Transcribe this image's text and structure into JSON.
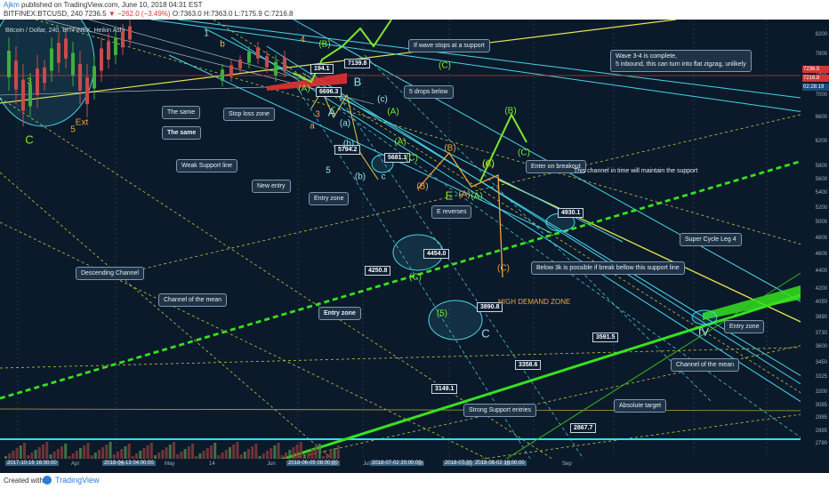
{
  "header": {
    "author": "Ajkm",
    "published": "published on TradingView.com, June 10, 2018 04:31 EST",
    "symbol_line": "BITFINEX:BTCUSD, 240 7236.5",
    "change": "▼ −262.0 (−3.49%)",
    "ohlc": "O:7363.0 H:7363.0 L:7175.9 C:7216.8"
  },
  "footer": {
    "created_with": "Created with",
    "brand": "TradingView"
  },
  "chart_data": {
    "type": "line",
    "title": "Bitcoin / Dollar, 240, BITFINEX, Heikin Ashi",
    "symbol": "BITFINEX:BTCUSD",
    "timeframe": "240",
    "y_axis": {
      "scale": "log",
      "ylim": [
        2700,
        8400
      ],
      "ticks": [
        8200,
        7800,
        7400,
        7000,
        6600,
        6200,
        5800,
        5600,
        5400,
        5200,
        5000,
        4800,
        4600,
        4400,
        4200,
        4050,
        3890,
        3730,
        3600,
        3450,
        3325,
        3200,
        3085,
        2985,
        2885,
        2790
      ]
    },
    "x_axis": {
      "ticks": [
        "2017-10-16 16:00:00",
        "Apr",
        "2018-04-13 04:00:00",
        "16",
        "May",
        "14",
        "Jun",
        "2018-06-05 08:00:00",
        "21",
        "Jul",
        "2018-07-02 20:00:00",
        "16",
        "2018-07-30 12:00:00",
        "Aug",
        "2018-08-02 16:00:00",
        "13",
        "Sep"
      ]
    },
    "current_price_labels": [
      "7236.5",
      "7216.8",
      "02:28:19"
    ],
    "price_tags": [
      "194.1",
      "7139.8",
      "6696.3",
      "5794.2",
      "5681.1",
      "4930.1",
      "4454.0",
      "4250.8",
      "3890.8",
      "3591.5",
      "3358.6",
      "3149.1",
      "2867.7"
    ],
    "annotations": [
      "If wave stops at a support",
      "Wave 3-4 is complete,\n5 inbound, this can turn into flat zigzag, unlikely",
      "5 drops below",
      "The same",
      "Stop loss zone",
      "The same",
      "Weak Support line",
      "New entry",
      "Entry zone",
      "Enter on breakout",
      "This channel in time will maintain the support",
      "E reverses",
      "Descending Channel",
      "Below 3k is possible if break bellow this support line",
      "Channel of the mean",
      "Entry zone",
      "HIGH DEMAND ZONE",
      "Super Cycle Leg 4",
      "Entry zone",
      "Channel of the mean",
      "Strong Support entries",
      "Absolute target"
    ],
    "wave_labels": [
      "3",
      "C",
      "5",
      "Ext",
      "1",
      "b",
      "4",
      "(B)",
      "(A)",
      "B",
      "a",
      "3",
      "A",
      "(a)",
      "(c)",
      "(A)",
      "(C)",
      "(b)",
      "5",
      "(b)",
      "c",
      "(A)",
      "(C)",
      "(B)",
      "(A)",
      "E",
      "(B)",
      "(C)",
      "(A)",
      "(C)",
      "(C)",
      "(5)",
      "C",
      "IV",
      "(B)",
      "(A)",
      "(C)"
    ],
    "colors": {
      "background": "#0b1a2b",
      "support_line": "#35e21f",
      "channel_cyan": "#47d6e6",
      "resistance_yellow": "#e8e44a",
      "stop_loss": "#e03131",
      "wave_green": "#7ee82c",
      "wave_orange": "#f0a43a",
      "price_line": "#e03131"
    },
    "grid": false,
    "legend": "none"
  }
}
